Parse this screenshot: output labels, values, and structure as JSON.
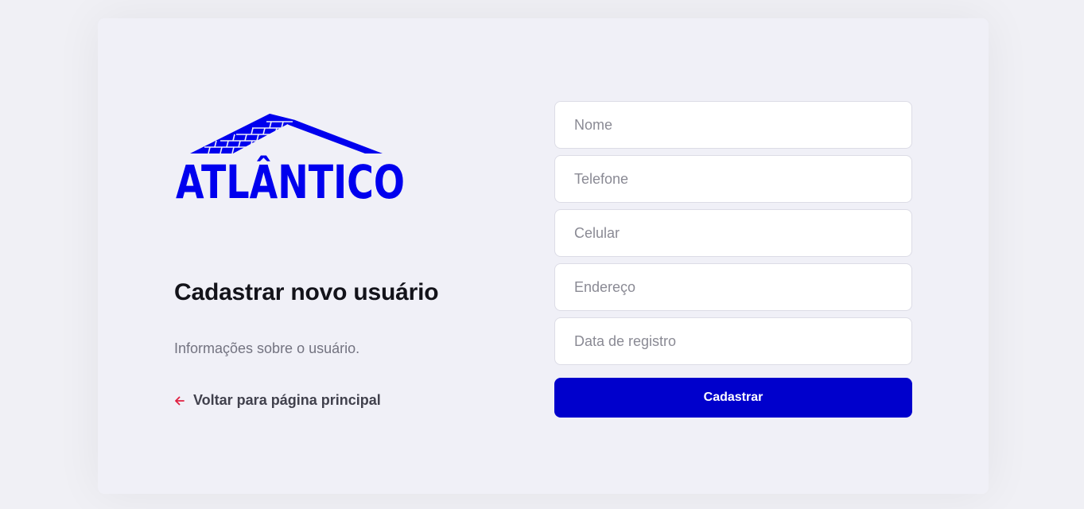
{
  "brand": {
    "logo_text": "ATLÂNTICO",
    "logo_icon": "roof-bricks-icon",
    "color": "#0000ee"
  },
  "intro": {
    "title": "Cadastrar novo usuário",
    "subtitle": "Informações sobre o usuário.",
    "back_link": "Voltar para página principal",
    "back_icon": "arrow-left-icon",
    "back_icon_color": "#e02041"
  },
  "form": {
    "fields": [
      {
        "placeholder": "Nome",
        "value": ""
      },
      {
        "placeholder": "Telefone",
        "value": ""
      },
      {
        "placeholder": "Celular",
        "value": ""
      },
      {
        "placeholder": "Endereço",
        "value": ""
      },
      {
        "placeholder": "Data de registro",
        "value": ""
      }
    ],
    "submit_label": "Cadastrar",
    "submit_color": "#0000cc"
  }
}
